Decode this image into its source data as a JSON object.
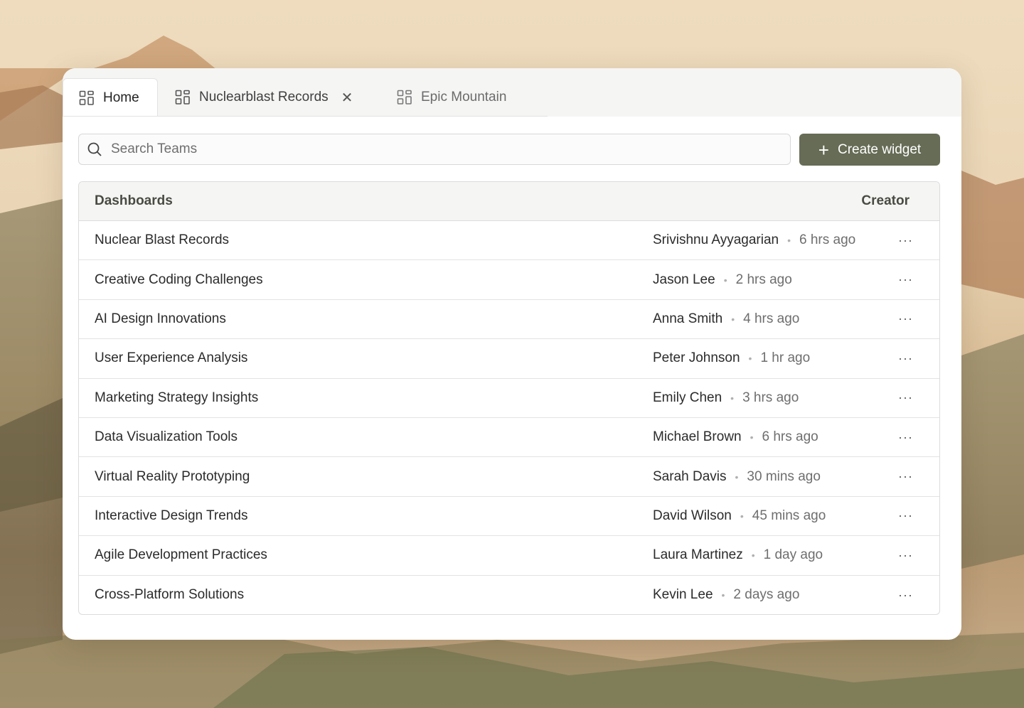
{
  "tabs": [
    {
      "label": "Home",
      "icon": "dashboard-grid-icon"
    },
    {
      "label": "Nuclearblast Records",
      "icon": "dashboard-grid-icon",
      "closable": true
    },
    {
      "label": "Epic Mountain",
      "icon": "dashboard-grid-icon"
    }
  ],
  "search": {
    "placeholder": "Search Teams",
    "icon": "search-icon"
  },
  "create_button": {
    "label": "Create widget",
    "icon": "plus-icon"
  },
  "table": {
    "headers": {
      "dashboards": "Dashboards",
      "creator": "Creator"
    },
    "rows": [
      {
        "name": "Nuclear Blast Records",
        "creator": "Srivishnu Ayyagarian",
        "time": "6 hrs ago"
      },
      {
        "name": "Creative Coding Challenges",
        "creator": "Jason Lee",
        "time": "2 hrs ago"
      },
      {
        "name": "AI Design Innovations",
        "creator": "Anna Smith",
        "time": "4 hrs ago"
      },
      {
        "name": "User Experience Analysis",
        "creator": "Peter Johnson",
        "time": "1 hr ago"
      },
      {
        "name": "Marketing Strategy Insights",
        "creator": "Emily Chen",
        "time": "3 hrs ago"
      },
      {
        "name": "Data Visualization Tools",
        "creator": "Michael Brown",
        "time": "6 hrs ago"
      },
      {
        "name": "Virtual Reality Prototyping",
        "creator": "Sarah Davis",
        "time": "30 mins ago"
      },
      {
        "name": "Interactive Design Trends",
        "creator": "David Wilson",
        "time": "45 mins ago"
      },
      {
        "name": "Agile Development Practices",
        "creator": "Laura Martinez",
        "time": "1 day ago"
      },
      {
        "name": "Cross-Platform Solutions",
        "creator": "Kevin Lee",
        "time": "2 days ago"
      }
    ],
    "row_menu_icon": "more-horizontal-icon",
    "separator": "•",
    "more_glyph": "···"
  },
  "colors": {
    "accent": "#666c55",
    "panel": "#ffffff",
    "tab_bar": "#f5f5f4"
  }
}
